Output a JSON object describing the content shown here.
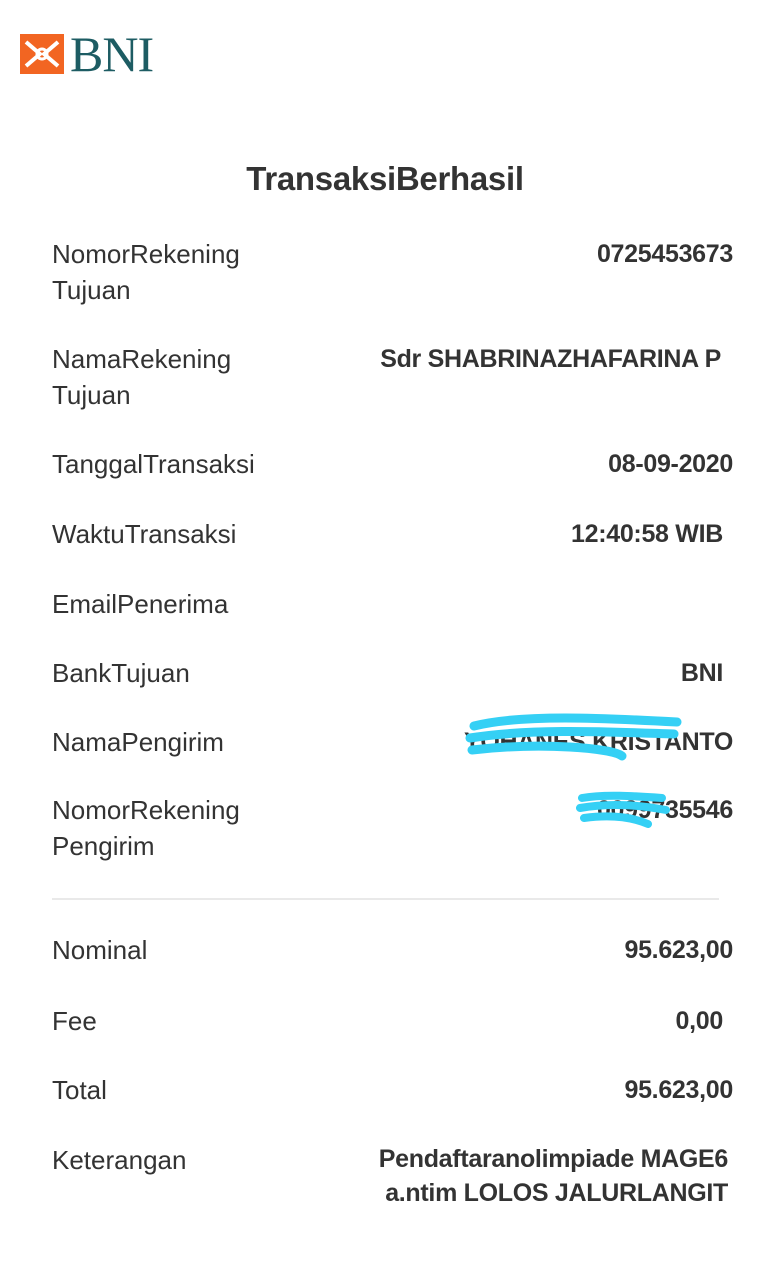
{
  "brand": {
    "name": "BNI",
    "primary_color": "#1d5c63",
    "accent_color": "#f26522"
  },
  "title": "TransaksiBerhasil",
  "details": [
    {
      "label": "NomorRekening Tujuan",
      "value": "0725453673"
    },
    {
      "label": "NamaRekening Tujuan",
      "value": "Sdr SHABRINAZHAFARINA P"
    },
    {
      "label": "TanggalTransaksi",
      "value": "08-09-2020"
    },
    {
      "label": "WaktuTransaksi",
      "value": "12:40:58 WIB"
    },
    {
      "label": "EmailPenerima",
      "value": ""
    },
    {
      "label": "BankTujuan",
      "value": "BNI"
    },
    {
      "label": "NamaPengirim",
      "value": "YOHANES KRISTANTO"
    },
    {
      "label": "NomorRekening Pengirim",
      "value": "0099735546"
    }
  ],
  "summary": [
    {
      "label": "Nominal",
      "value": "95.623,00"
    },
    {
      "label": "Fee",
      "value": "0,00"
    },
    {
      "label": "Total",
      "value": "95.623,00"
    },
    {
      "label": "Keterangan",
      "value": "Pendaftaranolimpiade MAGE6 a.ntim LOLOS JALURLANGIT"
    }
  ],
  "redaction_color": "#35d0f5"
}
